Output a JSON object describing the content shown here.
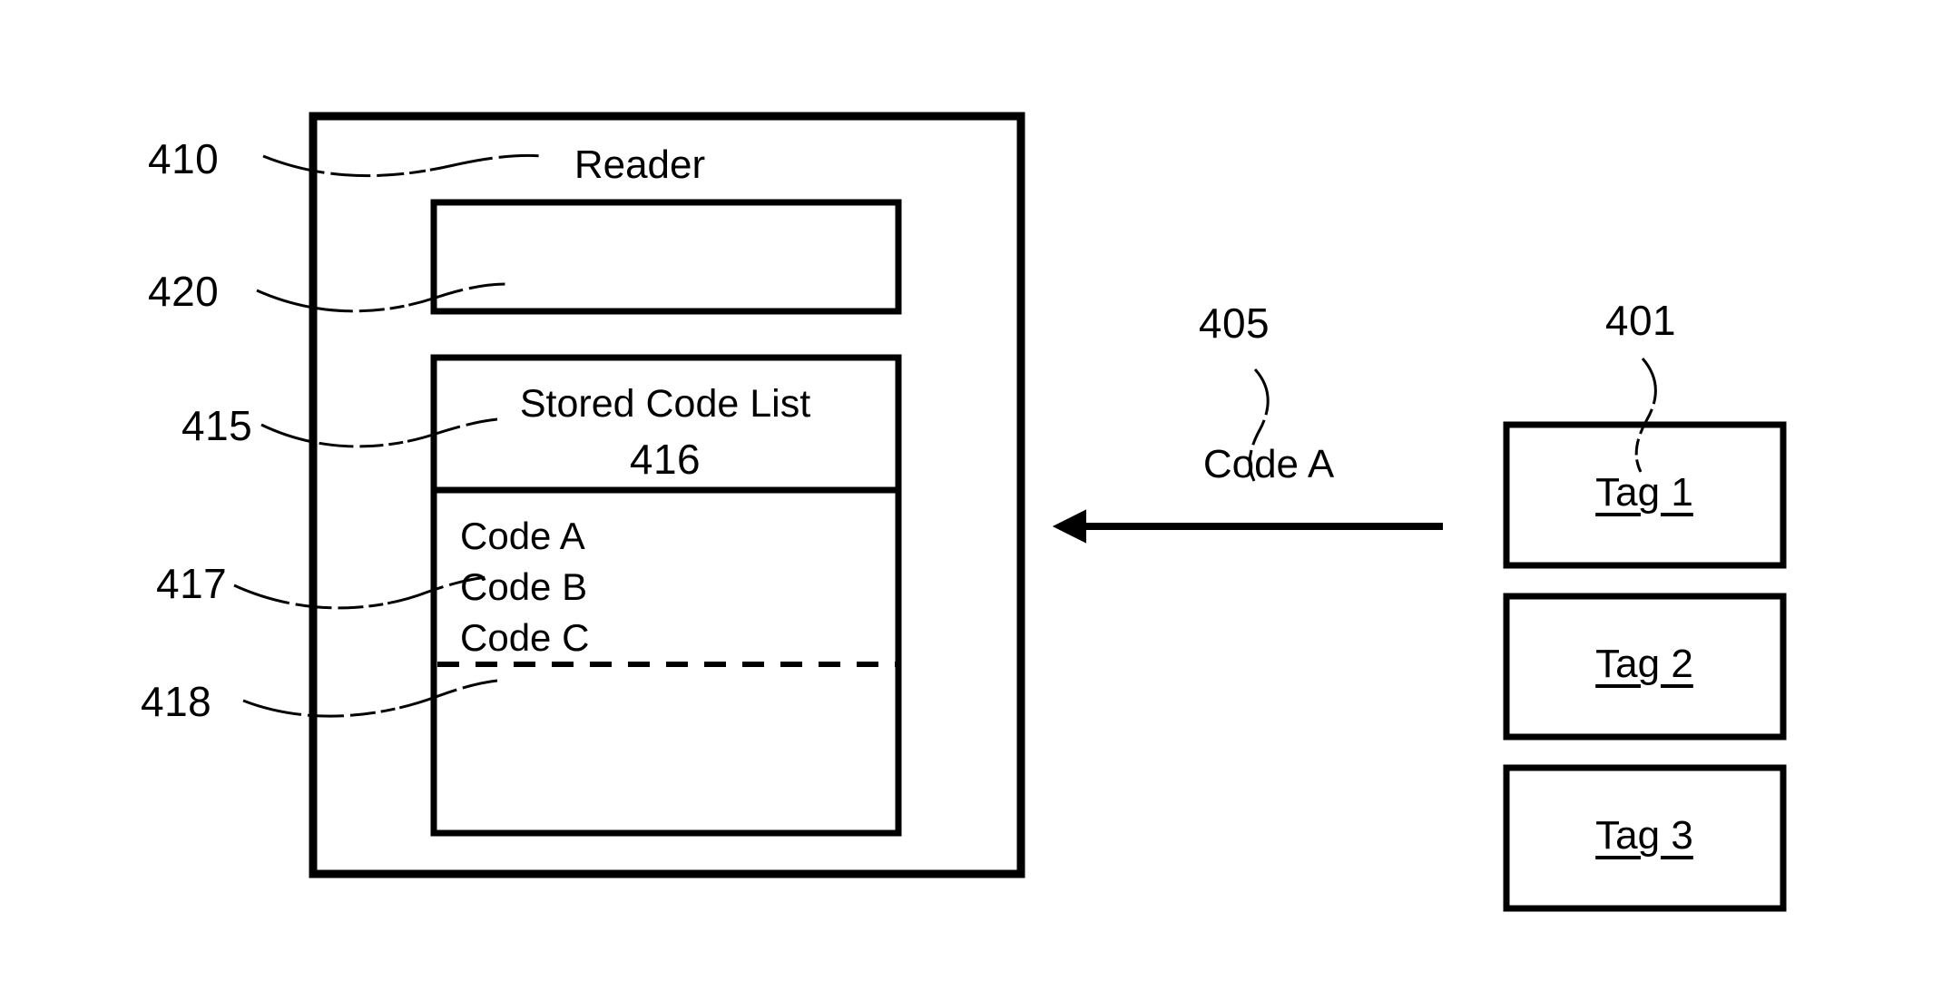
{
  "figure": {
    "title": "RFID Reader and Tag Code Transfer Diagram",
    "background_color": "#ffffff",
    "line_color": "#000000"
  },
  "reader": {
    "title": "Reader",
    "reference": "410",
    "antenna_block": {
      "reference": "420",
      "label": ""
    },
    "stored_code_list": {
      "reference": "415",
      "title": "Stored Code List",
      "title_reference": "416",
      "entries_reference": "417",
      "divider_reference": "418",
      "entries": [
        "Code A",
        "Code B",
        "Code C"
      ]
    }
  },
  "signal": {
    "reference": "405",
    "label": "Code A",
    "direction": "left"
  },
  "tags": {
    "reference": "401",
    "items": [
      {
        "label": "Tag 1"
      },
      {
        "label": "Tag 2"
      },
      {
        "label": "Tag 3"
      }
    ]
  }
}
